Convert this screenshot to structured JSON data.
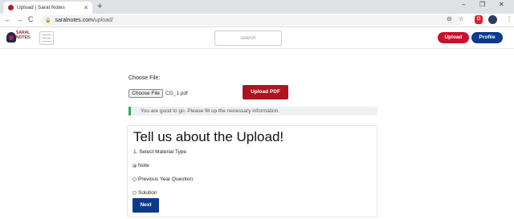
{
  "browser": {
    "tab_title": "Upload | Saral Notes",
    "tab_close": "✕",
    "new_tab": "+",
    "url_domain": "saralnotes.com",
    "url_path": "/upload/",
    "back": "←",
    "forward": "→",
    "reload": "C",
    "minimize": "–",
    "restore": "❐",
    "close": "✕",
    "zoom_icon": "⊖",
    "star_icon": "☆",
    "menu_icon": "⋮",
    "opera_badge": "O"
  },
  "header": {
    "logo_line1": "SARAL",
    "logo_line2": "NOTES",
    "search_placeholder": "search",
    "upload_label": "Upload",
    "profile_label": "Profile"
  },
  "form": {
    "choose_label": "Choose File:",
    "file_button": "Choose File",
    "file_name": "CG_1.pdf",
    "upload_pdf_label": "Upload PDF",
    "alert_text": "You are good to go. Please fill up the necessary information."
  },
  "card": {
    "title": "Tell us about the Upload!",
    "question": "1. Select Material Type",
    "options": [
      {
        "label": "Note",
        "selected": true
      },
      {
        "label": "Previous Year Question",
        "selected": false
      },
      {
        "label": "Solution",
        "selected": false
      }
    ],
    "next_label": "Next"
  },
  "colors": {
    "brand_red": "#c8102e",
    "brand_blue": "#0c3a8a",
    "alert_green": "#3aa657"
  }
}
